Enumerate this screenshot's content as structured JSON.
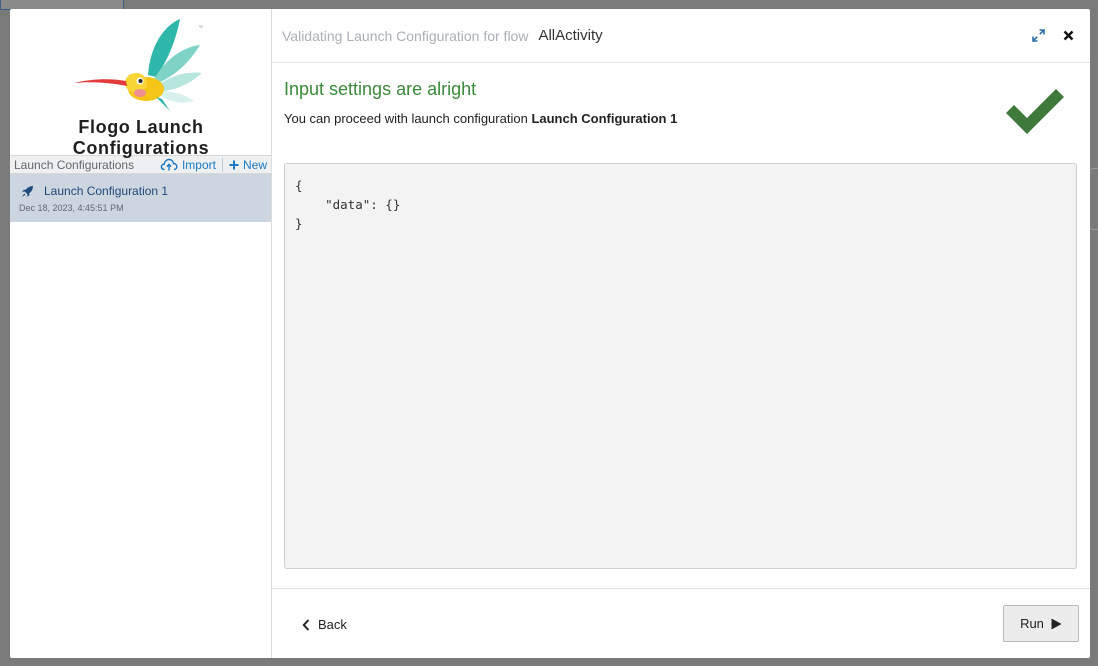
{
  "sidebar": {
    "app_title": "Flogo Launch Configurations",
    "section_label": "Launch Configurations",
    "import_label": "Import",
    "new_label": "New",
    "items": [
      {
        "name": "Launch Configuration 1",
        "date": "Dec 18, 2023, 4:45:51 PM"
      }
    ]
  },
  "header": {
    "prefix": "Validating Launch Configuration for flow",
    "flow_name": "AllActivity"
  },
  "status": {
    "title": "Input settings are alright",
    "message_prefix": "You can proceed with launch configuration",
    "config_name": "Launch Configuration 1"
  },
  "json_preview": "{\n    \"data\": {}\n}",
  "footer": {
    "back_label": "Back",
    "run_label": "Run"
  },
  "colors": {
    "success": "#3a8a3a",
    "accent": "#1a7ac4",
    "selected_item": "#cdd5e0"
  },
  "icons": [
    "hummingbird-logo",
    "upload-cloud-icon",
    "plus-icon",
    "rocket-icon",
    "expand-icon",
    "close-icon",
    "checkmark-icon",
    "chevron-left-icon",
    "play-icon"
  ]
}
